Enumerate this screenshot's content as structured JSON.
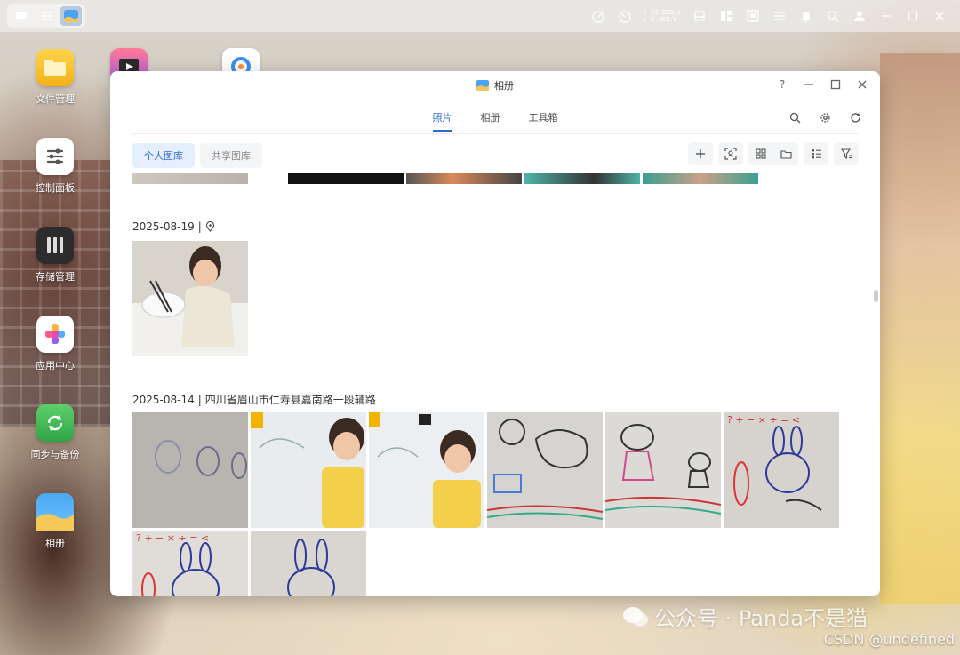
{
  "taskbar": {
    "net_up": "↑ 92.5KB/s",
    "net_down": "↓ 6.4KB/s"
  },
  "desktop_icons": [
    {
      "label": "文件管理"
    },
    {
      "label": "控制面板"
    },
    {
      "label": "存储管理"
    },
    {
      "label": "应用中心"
    },
    {
      "label": "同步与备份"
    },
    {
      "label": "相册"
    }
  ],
  "window": {
    "title": "相册",
    "help": "?",
    "tabs": [
      "照片",
      "相册",
      "工具箱"
    ],
    "active_tab": "照片",
    "library_tabs": [
      "个人图库",
      "共享图库"
    ],
    "groups": [
      {
        "date": "2025-08-19",
        "location": ""
      },
      {
        "date": "2025-08-14",
        "location": "四川省眉山市仁寿县嘉南路一段辅路"
      }
    ]
  },
  "watermark": {
    "text": "公众号 · Panda不是猫",
    "csdn": "CSDN @undefined"
  },
  "colors": {
    "accent": "#2b6bd6"
  }
}
